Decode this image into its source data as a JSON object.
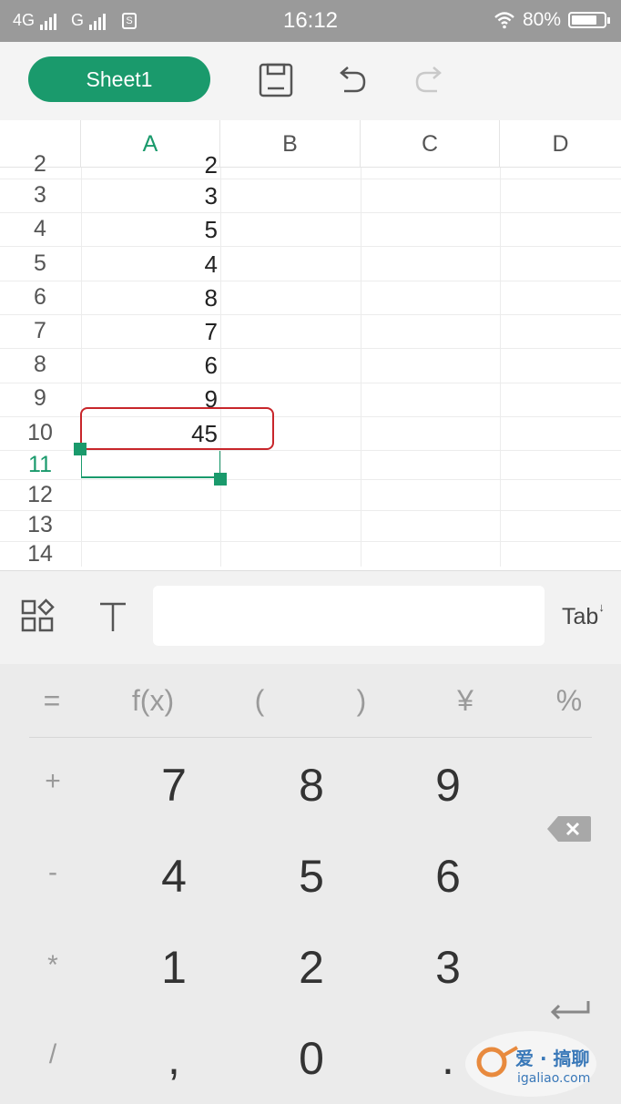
{
  "status_bar": {
    "network1": "4G",
    "network2": "G",
    "sim_label": "S",
    "time": "16:12",
    "battery": "80%"
  },
  "toolbar": {
    "sheet_tab": "Sheet1",
    "icons": [
      "save-icon",
      "undo-icon",
      "redo-icon"
    ]
  },
  "grid": {
    "columns": [
      "A",
      "B",
      "C",
      "D"
    ],
    "rows": [
      {
        "num": "2",
        "a": "2"
      },
      {
        "num": "3",
        "a": "3"
      },
      {
        "num": "4",
        "a": "5"
      },
      {
        "num": "5",
        "a": "4"
      },
      {
        "num": "6",
        "a": "8"
      },
      {
        "num": "7",
        "a": "7"
      },
      {
        "num": "8",
        "a": "6"
      },
      {
        "num": "9",
        "a": "9"
      },
      {
        "num": "10",
        "a": "45"
      },
      {
        "num": "11",
        "a": ""
      },
      {
        "num": "12",
        "a": ""
      },
      {
        "num": "13",
        "a": ""
      },
      {
        "num": "14",
        "a": ""
      }
    ],
    "active_row": "11",
    "active_column": "A"
  },
  "input_bar": {
    "formula_value": "",
    "tab_label": "Tab"
  },
  "keypad": {
    "function_keys": [
      "=",
      "f(x)",
      "(",
      ")",
      "¥",
      "%"
    ],
    "operators": [
      "+",
      "-",
      "*",
      "/"
    ],
    "rows": [
      [
        "7",
        "8",
        "9"
      ],
      [
        "4",
        "5",
        "6"
      ],
      [
        "1",
        "2",
        "3"
      ],
      [
        ",",
        "0",
        "."
      ]
    ]
  },
  "watermark": {
    "text": "爱 · 搞聊",
    "url": "igaliao.com"
  },
  "colors": {
    "accent": "#1a9a6c",
    "highlight": "#c8262b",
    "status_bar": "#9a9a9a"
  }
}
